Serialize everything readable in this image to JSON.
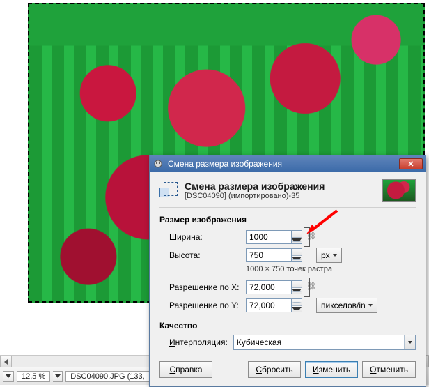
{
  "statusbar": {
    "zoom": "12,5 %",
    "file_title": "DSC04090.JPG (133,"
  },
  "dialog": {
    "window_title": "Смена размера изображения",
    "heading": "Смена размера изображения",
    "subheading": "[DSC04090] (импортировано)-35",
    "section_size": "Размер изображения",
    "width_label_pre": "Ш",
    "width_label_post": "ирина:",
    "width_value": "1000",
    "height_label_pre": "В",
    "height_label_post": "ысота:",
    "height_value": "750",
    "raster_desc": "1000 × 750 точек растра",
    "unit_px": "px",
    "resx_label": "Разрешение по X:",
    "resx_value": "72,000",
    "resy_label": "Разрешение по Y:",
    "resy_value": "72,000",
    "unit_res": "пикселов/in",
    "section_quality": "Качество",
    "interp_label_pre": "И",
    "interp_label_post": "нтерполяция:",
    "interp_value": "Кубическая",
    "btn_help_pre": "С",
    "btn_help_post": "правка",
    "btn_reset_pre": "С",
    "btn_reset_post": "бросить",
    "btn_resize_pre": "И",
    "btn_resize_post": "зменить",
    "btn_cancel_pre": "О",
    "btn_cancel_post": "тменить"
  }
}
